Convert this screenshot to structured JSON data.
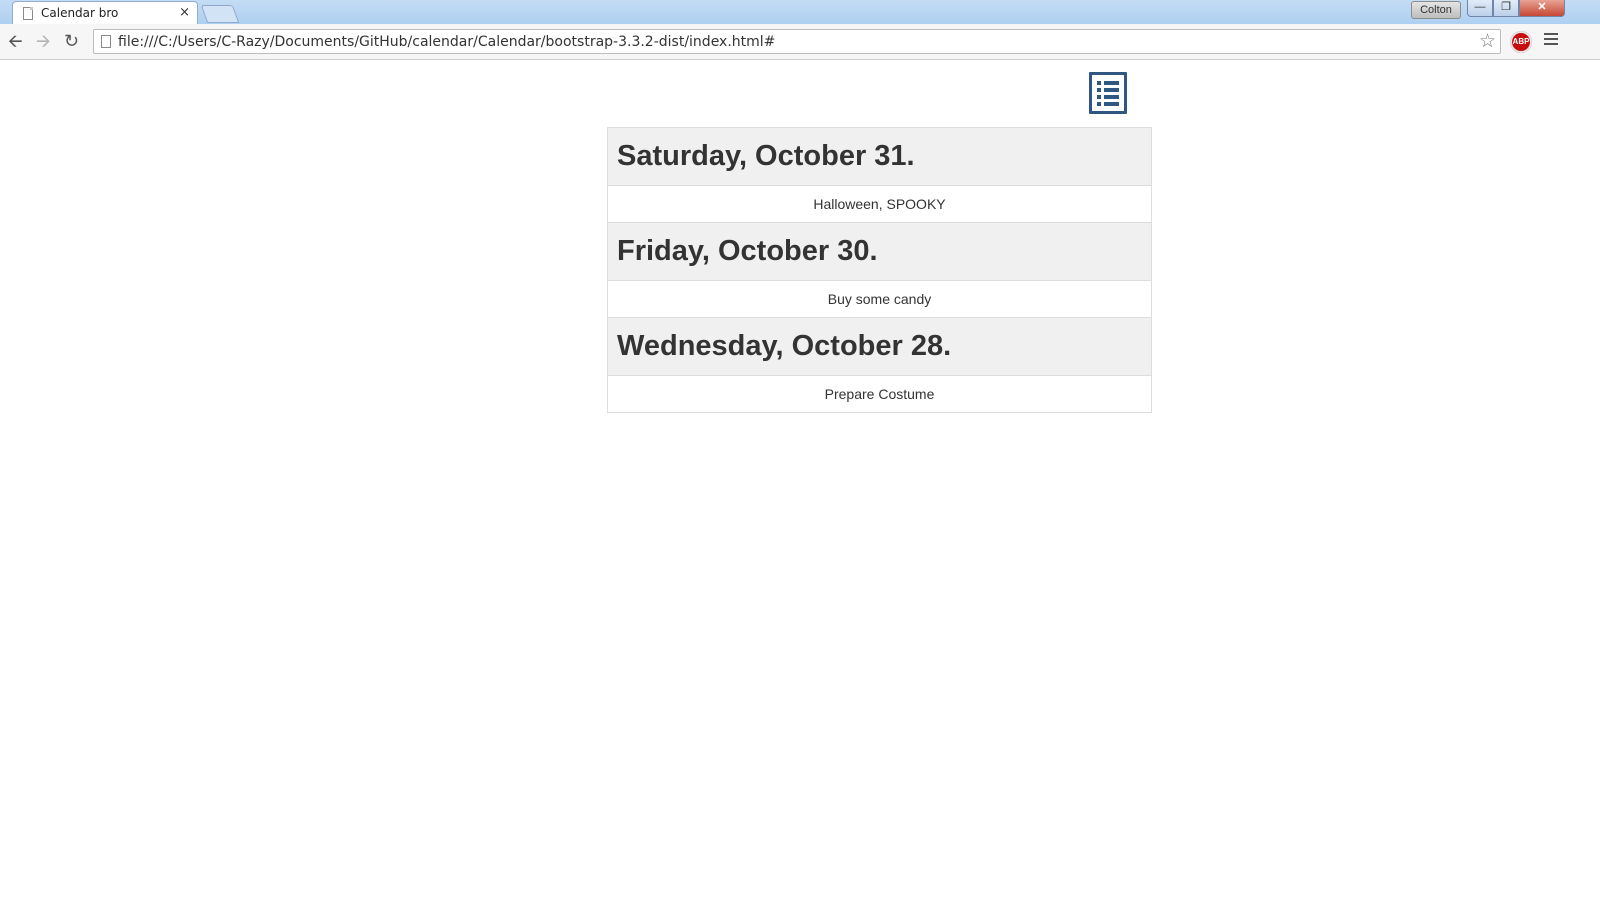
{
  "browser": {
    "tab_title": "Calendar bro",
    "tab_close": "×",
    "profile_name": "Colton",
    "url": "file:///C:/Users/C-Razy/Documents/GitHub/calendar/Calendar/bootstrap-3.3.2-dist/index.html#",
    "adblock_label": "ABP",
    "icons": {
      "back": "back-arrow-icon",
      "forward": "forward-arrow-icon",
      "reload": "reload-icon",
      "bookmark": "star-icon",
      "menu": "hamburger-menu-icon"
    }
  },
  "page": {
    "list_button_icon": "list-icon",
    "days": [
      {
        "date": "Saturday, October 31.",
        "event": "Halloween, SPOOKY"
      },
      {
        "date": "Friday, October 30.",
        "event": "Buy some candy"
      },
      {
        "date": "Wednesday, October 28.",
        "event": "Prepare Costume"
      }
    ]
  },
  "colors": {
    "accent": "#2f5782",
    "header_bg": "#f0f0f0",
    "border": "#dddddd",
    "text": "#333333"
  }
}
